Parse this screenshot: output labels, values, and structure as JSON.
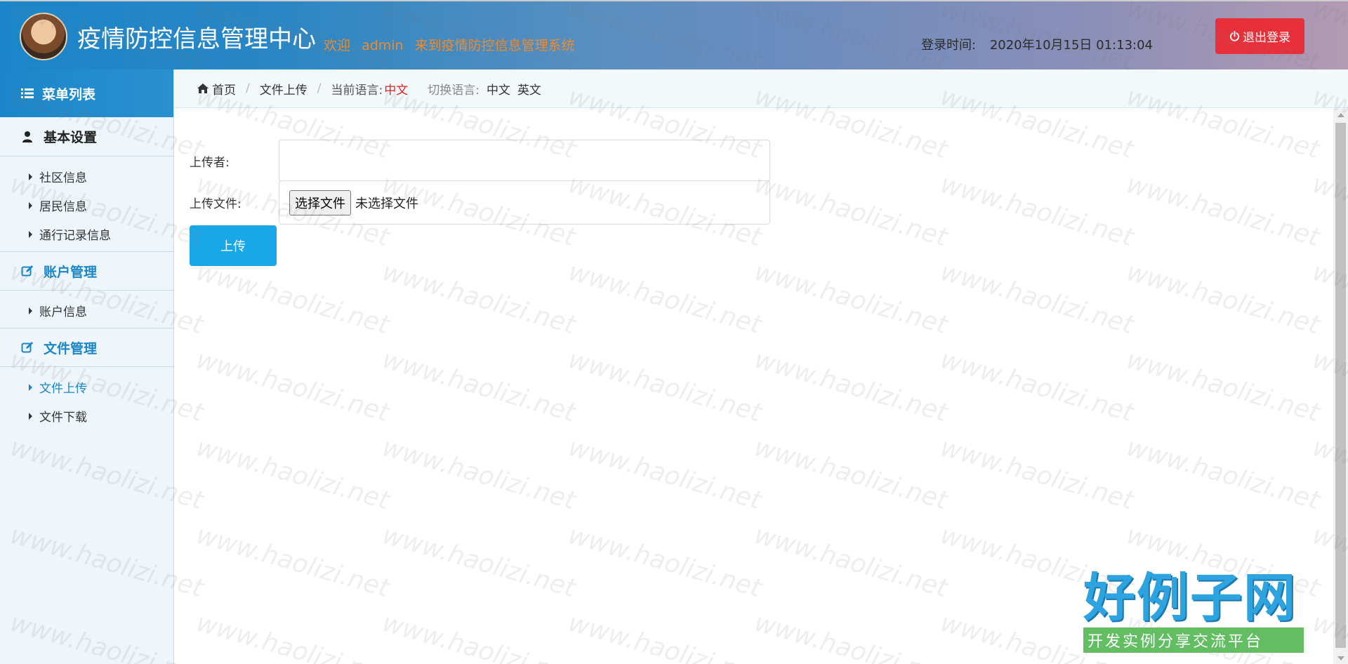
{
  "header": {
    "title": "疫情防控信息管理中心",
    "welcome_prefix": "欢迎",
    "username": "admin",
    "welcome_suffix": "来到疫情防控信息管理系统",
    "login_time_label": "登录时间:",
    "login_time_value": "2020年10月15日 01:13:04",
    "logout_label": "退出登录"
  },
  "sidebar": {
    "menu_title": "菜单列表",
    "groups": [
      {
        "title": "基本设置",
        "items": [
          "社区信息",
          "居民信息",
          "通行记录信息"
        ]
      },
      {
        "title": "账户管理",
        "items": [
          "账户信息"
        ]
      },
      {
        "title": "文件管理",
        "items": [
          "文件上传",
          "文件下载"
        ]
      }
    ]
  },
  "breadcrumb": {
    "home": "首页",
    "current": "文件上传",
    "lang_label": "当前语言:",
    "lang_current": "中文",
    "switch_label": "切换语言:",
    "lang_options": [
      "中文",
      "英文"
    ]
  },
  "form": {
    "uploader_label": "上传者:",
    "uploader_value": "",
    "file_label": "上传文件:",
    "file_button": "选择文件",
    "file_status": "未选择文件",
    "submit_label": "上传"
  },
  "watermark": "www.haolizi.net",
  "brand": {
    "main": "好例子网",
    "sub": "开发实例分享交流平台"
  },
  "colors": {
    "accent": "#1a86c9",
    "danger": "#e8303a",
    "button": "#1aa7e8",
    "welcome": "#f08a2a"
  }
}
